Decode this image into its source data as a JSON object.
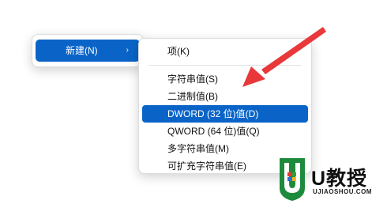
{
  "colors": {
    "highlight": "#0a64c8",
    "arrow": "#e8383a",
    "logo_green": "#1e8a3c"
  },
  "parent_menu": {
    "label": "新建(N)",
    "arrow_glyph": "›"
  },
  "submenu": {
    "items": [
      {
        "label": "项(K)"
      },
      {
        "label": "字符串值(S)"
      },
      {
        "label": "二进制值(B)"
      },
      {
        "label": "DWORD (32 位)值(D)"
      },
      {
        "label": "QWORD (64 位)值(Q)"
      },
      {
        "label": "多字符串值(M)"
      },
      {
        "label": "可扩充字符串值(E)"
      }
    ],
    "highlighted_index": 3
  },
  "annotation": {
    "icon": "red-arrow-icon"
  },
  "watermark": {
    "brand": "U教授",
    "url": "UJIAOSHOU.COM"
  }
}
